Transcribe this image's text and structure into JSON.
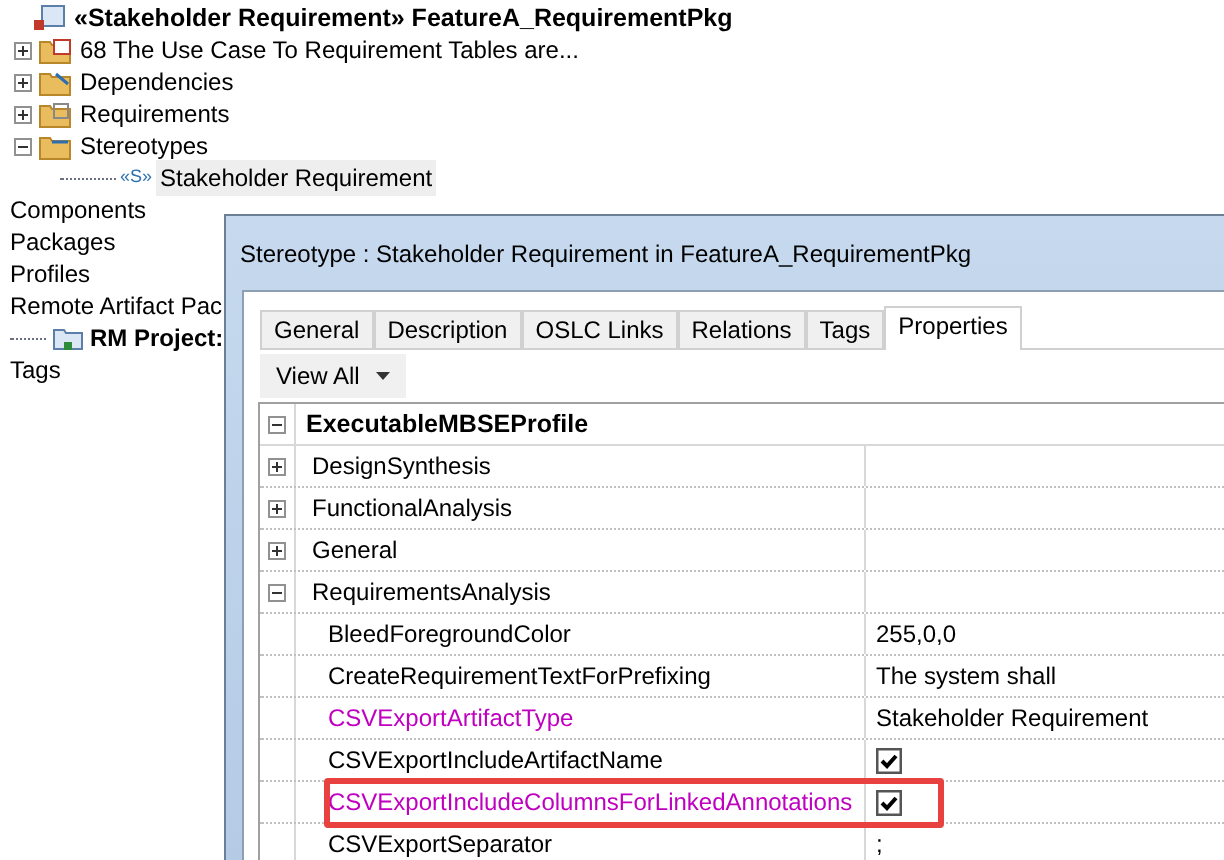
{
  "tree": {
    "root": {
      "label": "«Stakeholder Requirement» FeatureA_RequirementPkg"
    },
    "items": [
      {
        "label": "68 The Use Case To Requirement Tables are...",
        "kind": "table",
        "expanded": false
      },
      {
        "label": "Dependencies",
        "kind": "dependency",
        "expanded": false
      },
      {
        "label": "Requirements",
        "kind": "requirement",
        "expanded": false
      },
      {
        "label": "Stereotypes",
        "kind": "stereotype",
        "expanded": true,
        "children": [
          {
            "mark": "«S»",
            "label": "Stakeholder Requirement",
            "selected": true
          }
        ]
      }
    ],
    "categories": [
      {
        "label": "Components"
      },
      {
        "label": "Packages"
      },
      {
        "label": "Profiles"
      },
      {
        "label": "Remote Artifact Pac"
      },
      {
        "label": "RM Project:",
        "kind": "project"
      },
      {
        "label": "Tags"
      }
    ]
  },
  "dialog": {
    "title": "Stereotype : Stakeholder Requirement in FeatureA_RequirementPkg",
    "tabs": [
      {
        "label": "General",
        "selected": false
      },
      {
        "label": "Description",
        "selected": false
      },
      {
        "label": "OSLC Links",
        "selected": false
      },
      {
        "label": "Relations",
        "selected": false
      },
      {
        "label": "Tags",
        "selected": false
      },
      {
        "label": "Properties",
        "selected": true
      }
    ],
    "view_button": {
      "label": "View All"
    },
    "profile": {
      "label": "ExecutableMBSEProfile",
      "expanded": true
    },
    "rows": [
      {
        "kind": "group",
        "label": "DesignSynthesis",
        "expanded": false
      },
      {
        "kind": "group",
        "label": "FunctionalAnalysis",
        "expanded": false
      },
      {
        "kind": "group",
        "label": "General",
        "expanded": false
      },
      {
        "kind": "group",
        "label": "RequirementsAnalysis",
        "expanded": true
      },
      {
        "kind": "text",
        "label": "BleedForegroundColor",
        "value": "255,0,0",
        "modified": false,
        "outlined": false
      },
      {
        "kind": "text",
        "label": "CreateRequirementTextForPrefixing",
        "value": "The system shall",
        "modified": false,
        "outlined": false
      },
      {
        "kind": "text",
        "label": "CSVExportArtifactType",
        "value": "Stakeholder Requirement",
        "modified": true,
        "outlined": false
      },
      {
        "kind": "checkbox",
        "label": "CSVExportIncludeArtifactName",
        "checked": true,
        "modified": false,
        "outlined": false
      },
      {
        "kind": "checkbox",
        "label": "CSVExportIncludeColumnsForLinkedAnnotations",
        "checked": true,
        "modified": true,
        "outlined": true
      },
      {
        "kind": "text",
        "label": "CSVExportSeparator",
        "value": ";",
        "modified": false,
        "outlined": false
      }
    ]
  }
}
